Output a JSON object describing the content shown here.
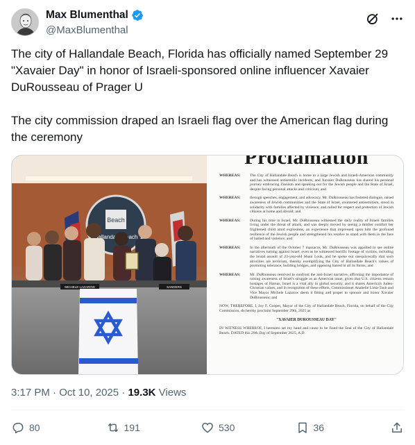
{
  "author": {
    "display_name": "Max Blumenthal",
    "handle": "@MaxBlumenthal",
    "verified": true,
    "verified_color": "#1d9bf0"
  },
  "header_icons": [
    "grok-icon",
    "more-icon"
  ],
  "tweet": {
    "paragraphs": [
      "The city of Hallandale Beach, Florida has officially named September 29 \"Xavaier Day\" in honor of Israeli-sponsored online influencer Xavaier DuRousseau of Prager U",
      "The city commission draped an Israeli flag over the American flag during the ceremony"
    ]
  },
  "media": {
    "photo_sign_text": [
      "Beach",
      "Hallandale Beach"
    ],
    "photo_nameplates": [
      "MICHELE LAZAROW",
      "SANDERS"
    ],
    "proclamation": {
      "title": "Proclamation",
      "clauses": [
        {
          "label": "WHEREAS:",
          "text": "The City of Hallandale Beach is home to a large Jewish and Israeli-American community and has witnessed antisemitic incidents, and Xavaier DuRousseau has shared his personal journey embracing Zionism and speaking out for the Jewish people and the State of Israel, despite facing personal attacks and criticism; and"
        },
        {
          "label": "WHEREAS:",
          "text": "through speeches, engagement, and advocacy, Mr. DuRousseau has fostered dialogue, raised awareness of Jewish communities and the State of Israel, countered antisemitism, stood in solidarity with families affected by violence, and called for respect and protection of Jewish citizens at home and abroad; and"
        },
        {
          "label": "WHEREAS:",
          "text": "During his time in Israel, Mr. DuRousseau witnessed the daily reality of Israeli families living under the threat of attack, and was deeply moved by seeing a mother comfort her frightened child amid explosions, an experience that impressed upon him the profound resilience of the Jewish people and strengthened his resolve to stand with them in the face of hatred and violence; and"
        },
        {
          "label": "WHEREAS:",
          "text": "In the aftermath of the October 7 massacre, Mr. DuRousseau was appalled to see online narratives turning against Israel, even as he witnessed horrific footage of victims, including the brutal assault of 23-year-old Shani Louk, and he spoke out unequivocally that such atrocities are terrorism, thereby exemplifying the City of Hallandale Beach's values of promoting tolerance, building bridges, and opposing hatred in all its forms; and"
        },
        {
          "label": "WHEREAS:",
          "text": "Mr. DuRousseau resolved to confront the anti-Israel narrative, affirming the importance of raising awareness of Israel's struggle as an American issue, given that U.S. citizens remain hostages of Hamas, Israel is a vital ally in global security, and it shares America's Judeo-Christian values, and in recognition of these efforts, Commissioner Anabelle Lima-Taub and Vice Mayor Michele Lazarow deem it fitting and proper to sponsor and honor Xavaier DuRousseau; and"
        }
      ],
      "now_therefore": "NOW, THEREFORE, I, Joy F. Cooper, Mayor of the City of Hallandale Beach, Florida, on behalf of the City Commission, do hereby proclaim September 29th, 2025 as",
      "day_name": "\"XAVAIER DUROUSSEAU DAY\"",
      "witness": "IN WITNESS WHEREOF, I hereunto set my hand and cause to be fixed the Seal of the City of Hallandale Beach. DATED this 29th Day of September 2025, A.D."
    }
  },
  "meta": {
    "time": "3:17 PM",
    "separator": "·",
    "date": "Oct 10, 2025",
    "views_count": "19.3K",
    "views_label": "Views"
  },
  "actions": {
    "replies": "80",
    "reposts": "191",
    "likes": "530",
    "bookmarks": "36"
  }
}
